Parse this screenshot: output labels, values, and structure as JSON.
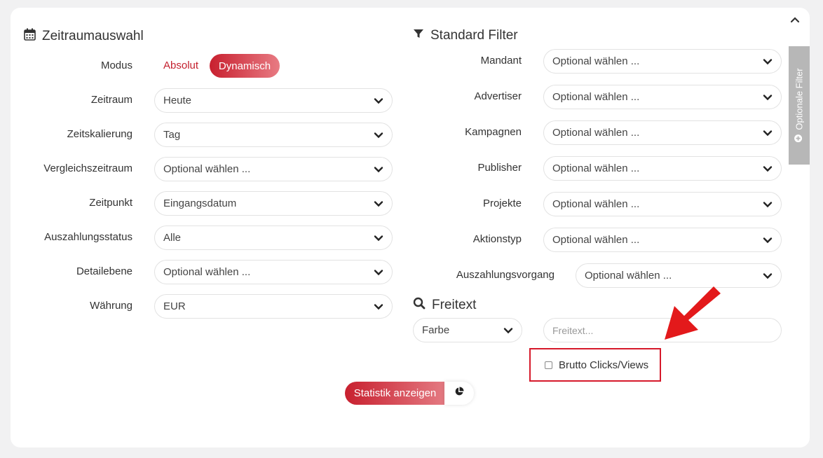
{
  "colors": {
    "accent": "#c8202f",
    "arrow": "#e3191b",
    "highlight_border": "#d6192a",
    "side_tab": "#b7b7b7"
  },
  "collapse_icon": "chevron-up-icon",
  "time_section": {
    "title": "Zeitraumauswahl",
    "icon": "calendar-icon",
    "mode": {
      "label": "Modus",
      "options": [
        "Absolut",
        "Dynamisch"
      ],
      "active": "Dynamisch"
    },
    "fields": [
      {
        "label": "Zeitraum",
        "value": "Heute"
      },
      {
        "label": "Zeitskalierung",
        "value": "Tag"
      },
      {
        "label": "Vergleichszeitraum",
        "value": "Optional wählen ..."
      },
      {
        "label": "Zeitpunkt",
        "value": "Eingangsdatum"
      },
      {
        "label": "Auszahlungsstatus",
        "value": "Alle"
      },
      {
        "label": "Detailebene",
        "value": "Optional wählen ..."
      },
      {
        "label": "Währung",
        "value": "EUR"
      }
    ]
  },
  "filter_section": {
    "title": "Standard Filter",
    "icon": "filter-icon",
    "fields": [
      {
        "label": "Mandant",
        "value": "Optional wählen ..."
      },
      {
        "label": "Advertiser",
        "value": "Optional wählen ..."
      },
      {
        "label": "Kampagnen",
        "value": "Optional wählen ..."
      },
      {
        "label": "Publisher",
        "value": "Optional wählen ..."
      },
      {
        "label": "Projekte",
        "value": "Optional wählen ..."
      },
      {
        "label": "Aktionstyp",
        "value": "Optional wählen ..."
      },
      {
        "label": "Auszahlungsvorgang",
        "value": "Optional wählen ..."
      }
    ]
  },
  "freetext_section": {
    "title": "Freitext",
    "icon": "search-icon",
    "field_select": "Farbe",
    "input_placeholder": "Freitext..."
  },
  "checkbox": {
    "label": "Brutto Clicks/Views",
    "checked": false
  },
  "side_tab": {
    "label": "Optionale Filter",
    "icon": "plus-circle-icon"
  },
  "actions": {
    "submit_label": "Statistik anzeigen",
    "chart_icon": "pie-chart-icon"
  }
}
